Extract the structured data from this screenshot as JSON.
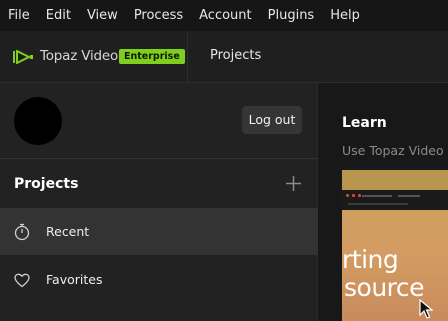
{
  "menubar": {
    "items": [
      "File",
      "Edit",
      "View",
      "Process",
      "Account",
      "Plugins",
      "Help"
    ]
  },
  "topbar": {
    "brand": "Topaz Video",
    "badge": "Enterprise",
    "nav_projects": "Projects"
  },
  "sidebar": {
    "logout_label": "Log out",
    "section_title": "Projects",
    "items": [
      {
        "label": "Recent",
        "icon": "stopwatch-icon",
        "active": true
      },
      {
        "label": "Favorites",
        "icon": "heart-icon",
        "active": false
      }
    ]
  },
  "main": {
    "learn_title": "Learn",
    "learn_subtitle": "Use Topaz Video lik",
    "card": {
      "line1": "rting",
      "line2": "source"
    }
  },
  "colors": {
    "accent": "#7fcf1e",
    "background": "#1b1b1b",
    "active_row": "#333333"
  }
}
